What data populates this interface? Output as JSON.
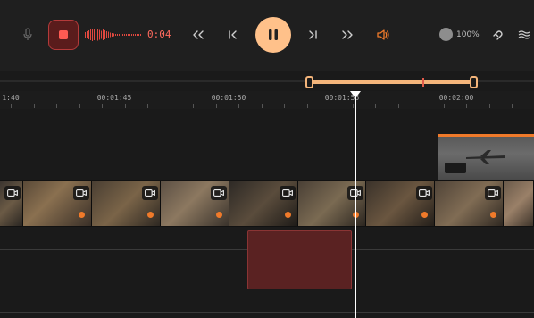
{
  "toolbar": {
    "recording_time": "0:04",
    "zoom_level": "100%",
    "icons": [
      "mic-icon",
      "stop-icon",
      "waveform",
      "seek-back-icon",
      "prev-icon",
      "pause-icon",
      "next-icon",
      "seek-forward-icon",
      "volume-icon",
      "zoom-icon",
      "magnet-icon",
      "menu-icon"
    ]
  },
  "ruler": {
    "labels": [
      "1:40",
      "00:01:45",
      "00:01:50",
      "00:01:55",
      "00:02:00"
    ]
  },
  "colors": {
    "accent": "#ffc18a",
    "record_red": "#ff5a52",
    "clip_orange": "#f07a2a",
    "audio_clip": "#5a2222"
  }
}
